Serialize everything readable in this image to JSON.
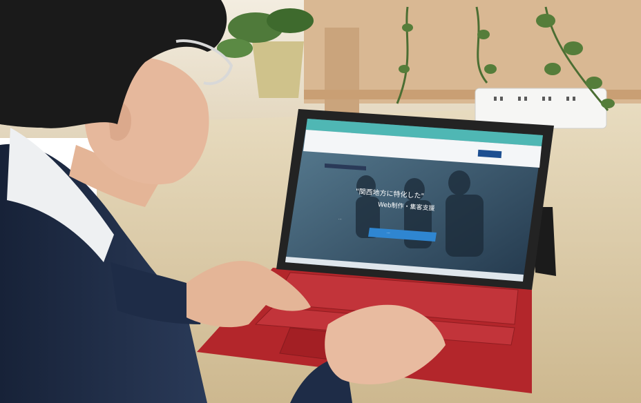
{
  "scene": {
    "colors": {
      "desk": "#d9c9a6",
      "wall": "#efe6d4",
      "shelf": "#d8b58e",
      "suit": "#1c2b45",
      "shirt": "#eef0f2",
      "hair": "#1a1a1a",
      "skin": "#e6b89c",
      "keyboard": "#b3262b",
      "tablet_frame": "#232323",
      "browser_bar": "#4fb7b4",
      "site_header": "#f4f6f8",
      "hero": "#3a5d78",
      "cta": "#2f86d1"
    }
  },
  "screen": {
    "headline_line1": "\"関西地方に特化した\"",
    "headline_line2": "Web制作・集客支援",
    "subtext": "...",
    "cta_label": "..."
  }
}
